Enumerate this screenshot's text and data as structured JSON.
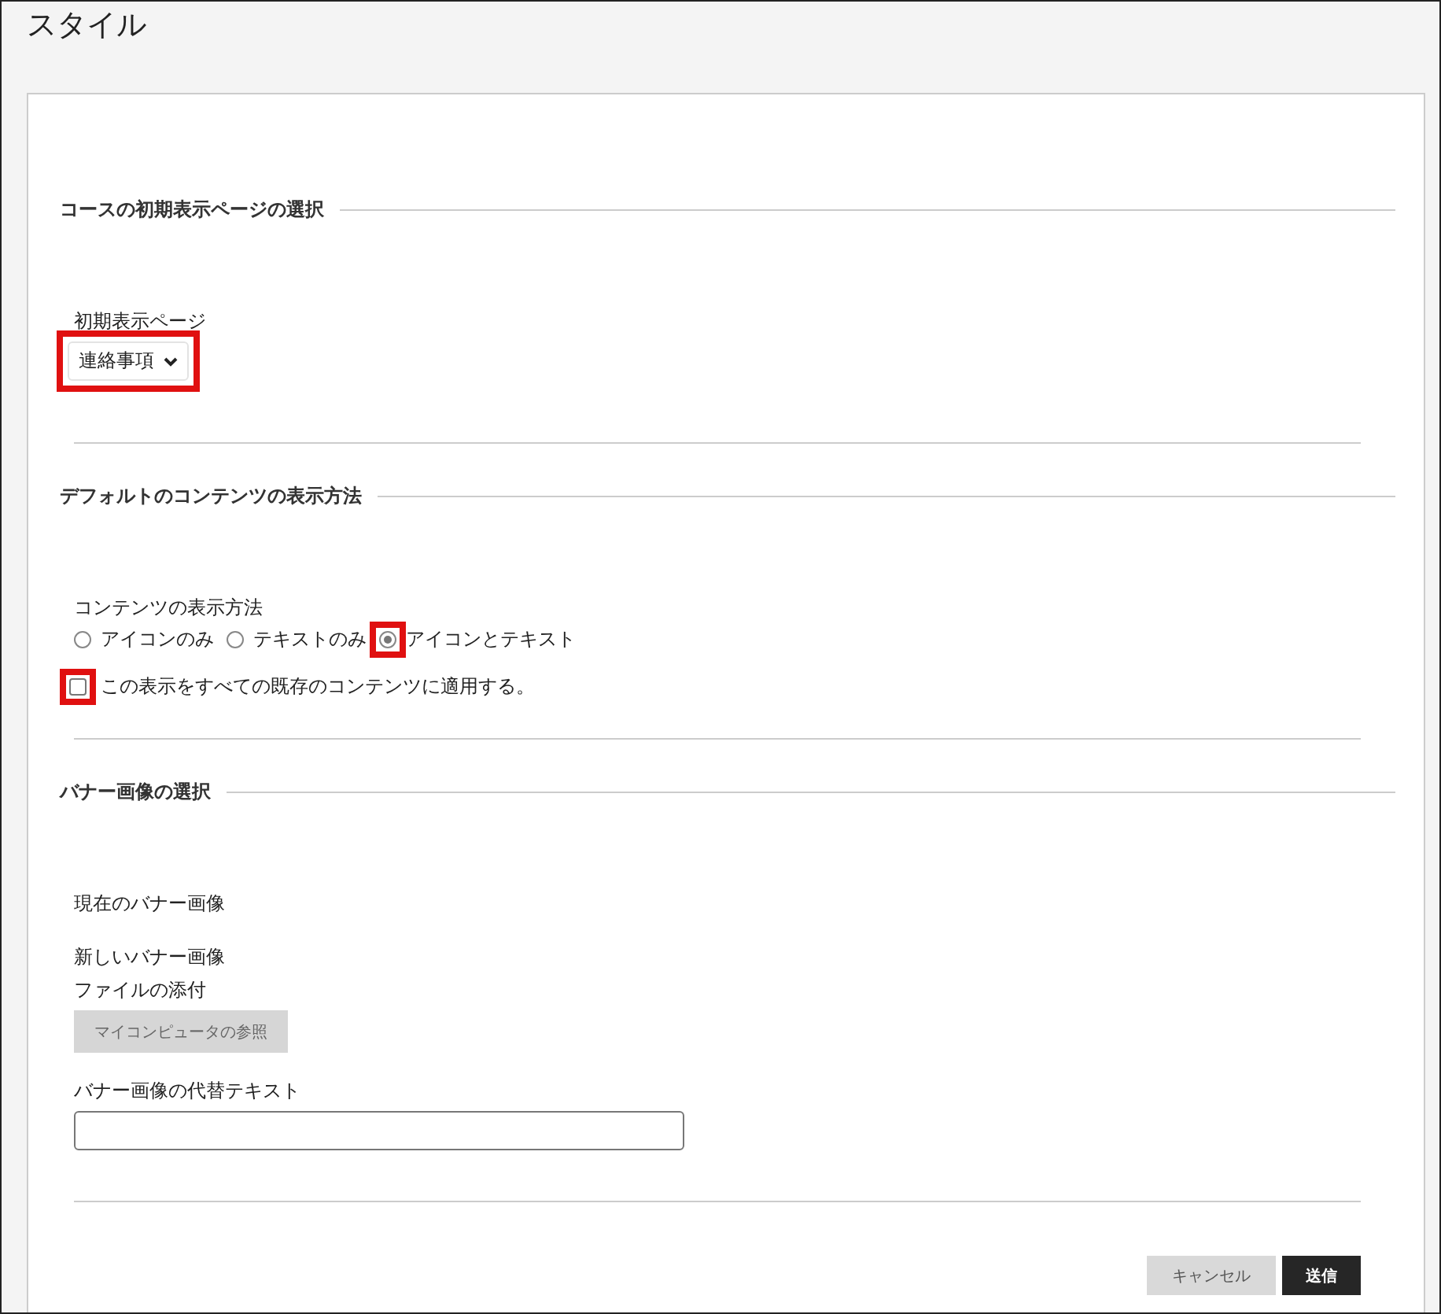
{
  "window": {
    "title": "スタイル"
  },
  "sections": [
    {
      "heading": "コースの初期表示ページの選択",
      "fields": [
        {
          "kind": "select",
          "label": "初期表示ページ",
          "value": "連絡事項",
          "highlighted": true
        }
      ]
    },
    {
      "heading": "デフォルトのコンテンツの表示方法",
      "fields": [
        {
          "kind": "radio",
          "label": "コンテンツの表示方法",
          "options": [
            {
              "label": "アイコンのみ",
              "selected": false,
              "highlighted": false
            },
            {
              "label": "テキストのみ",
              "selected": false,
              "highlighted": false
            },
            {
              "label": "アイコンとテキスト",
              "selected": true,
              "highlighted": true
            }
          ]
        },
        {
          "kind": "checkbox",
          "label": "この表示をすべての既存のコンテンツに適用する。",
          "checked": false,
          "highlighted": true
        }
      ]
    },
    {
      "heading": "バナー画像の選択",
      "fields": [
        {
          "kind": "text",
          "label": "現在のバナー画像"
        },
        {
          "kind": "file",
          "label": "新しいバナー画像",
          "sublabel": "ファイルの添付",
          "button": "マイコンピュータの参照"
        },
        {
          "kind": "input",
          "label": "バナー画像の代替テキスト"
        }
      ]
    }
  ],
  "buttons": [
    {
      "label": "キャンセル",
      "primary": false
    },
    {
      "label": "送信",
      "primary": true
    }
  ]
}
